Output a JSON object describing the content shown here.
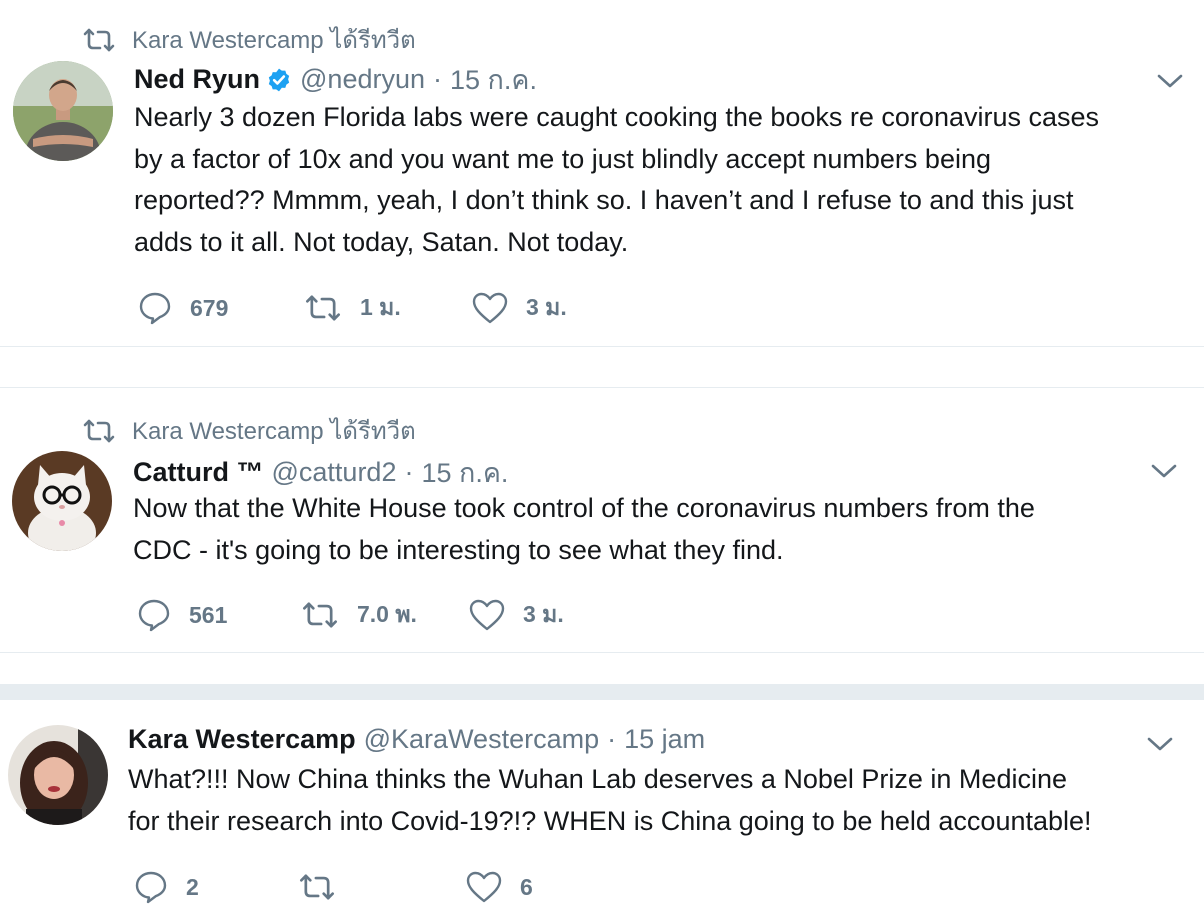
{
  "tweets": [
    {
      "retweeted_by": "Kara Westercamp ได้รีทวีต",
      "name": "Ned Ryun",
      "verified": true,
      "handle": "@nedryun",
      "dot": "·",
      "time": "15 ก.ค.",
      "lines": [
        "Nearly 3 dozen Florida labs were caught cooking the books re coronavirus cases",
        "by a factor of 10x and you want me to just blindly accept numbers being",
        "reported?? Mmmm, yeah, I don’t think so. I haven’t and I refuse to and this just",
        "adds to it all. Not today, Satan. Not today."
      ],
      "replies": "679",
      "retweets": "1 ม.",
      "likes": "3 ม."
    },
    {
      "retweeted_by": "Kara Westercamp ได้รีทวีต",
      "name": "Catturd ™",
      "verified": false,
      "handle": "@catturd2",
      "dot": "·",
      "time": "15 ก.ค.",
      "lines": [
        "Now that the White House took control of the coronavirus numbers from the",
        "CDC - it's going to be interesting to see what they find."
      ],
      "replies": "561",
      "retweets": "7.0 พ.",
      "likes": "3 ม."
    },
    {
      "retweeted_by": "",
      "name": "Kara Westercamp",
      "verified": false,
      "handle": "@KaraWestercamp",
      "dot": "·",
      "time": "15 jam",
      "lines": [
        "What?!!! Now China thinks the Wuhan Lab deserves a Nobel Prize in Medicine",
        "for their research into Covid-19?!? WHEN is China going to be held accountable!"
      ],
      "replies": "2",
      "retweets": "",
      "likes": "6"
    }
  ],
  "colors": {
    "text": "#14171a",
    "muted": "#657786",
    "verified": "#1da1f2",
    "separator": "#e6ecf0"
  },
  "icons": [
    "retweet-icon",
    "verified-badge-icon",
    "chevron-down-icon",
    "reply-icon",
    "like-icon"
  ]
}
